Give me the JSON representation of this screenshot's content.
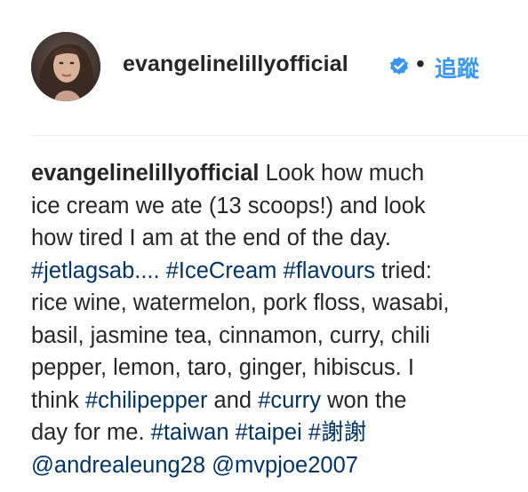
{
  "post": {
    "username": "evangelinelillyofficial",
    "separator": "•",
    "follow_label": "追蹤",
    "verified_icon": "verified-badge-icon",
    "avatar_icon": "profile-photo-avatar",
    "accent_color": "#3897f0",
    "link_color": "#003569"
  },
  "caption": {
    "author": "evangelinelillyofficial",
    "line1_text": " Look how much",
    "line2_text": "ice cream we ate (13 scoops!) and look",
    "line3_text": "how tired I am at the end of the day.",
    "tag_jetlag": "#jetlagsab....",
    "space1": " ",
    "tag_icecream": "#IceCream",
    "space2": " ",
    "tag_flavours": "#flavours",
    "line4_tail": " tried:",
    "line5_text": "rice wine, watermelon, pork floss, wasabi,",
    "line6_text": "basil, jasmine tea, cinnamon, curry, chili",
    "line7_text": "pepper, lemon, taro, ginger, hibiscus. I",
    "line8_head": "think ",
    "tag_chilipepper": "#chilipepper",
    "line8_mid": " and ",
    "tag_curry": "#curry",
    "line8_tail": " won the",
    "line9_head": "day for me. ",
    "tag_taiwan": "#taiwan",
    "space3": " ",
    "tag_taipei": "#taipei",
    "space4": " ",
    "tag_xiexie": "#謝謝",
    "mention1": "@andrealeung28",
    "space5": " ",
    "mention2": "@mvpjoe2007"
  }
}
